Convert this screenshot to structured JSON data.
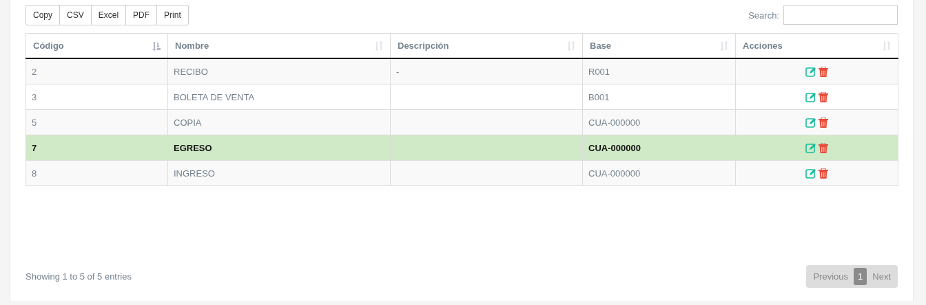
{
  "export_buttons": [
    "Copy",
    "CSV",
    "Excel",
    "PDF",
    "Print"
  ],
  "search": {
    "label": "Search:"
  },
  "table": {
    "columns": [
      {
        "label": "Código",
        "sorted": true
      },
      {
        "label": "Nombre",
        "sorted": false
      },
      {
        "label": "Descripción",
        "sorted": false
      },
      {
        "label": "Base",
        "sorted": false
      },
      {
        "label": "Acciones",
        "sorted": false
      }
    ],
    "rows": [
      {
        "cells": [
          "2",
          "RECIBO",
          "-",
          "R001"
        ],
        "selected": false
      },
      {
        "cells": [
          "3",
          "BOLETA DE VENTA",
          "",
          "B001"
        ],
        "selected": false
      },
      {
        "cells": [
          "5",
          "COPIA",
          "",
          "CUA-000000"
        ],
        "selected": false
      },
      {
        "cells": [
          "7",
          "EGRESO",
          "",
          "CUA-000000"
        ],
        "selected": true
      },
      {
        "cells": [
          "8",
          "INGRESO",
          "",
          "CUA-000000"
        ],
        "selected": false
      }
    ]
  },
  "info": "Showing 1 to 5 of 5 entries",
  "pagination": [
    {
      "label": "Previous",
      "selected": false
    },
    {
      "label": "1",
      "selected": true
    },
    {
      "label": "Next",
      "selected": false
    }
  ]
}
